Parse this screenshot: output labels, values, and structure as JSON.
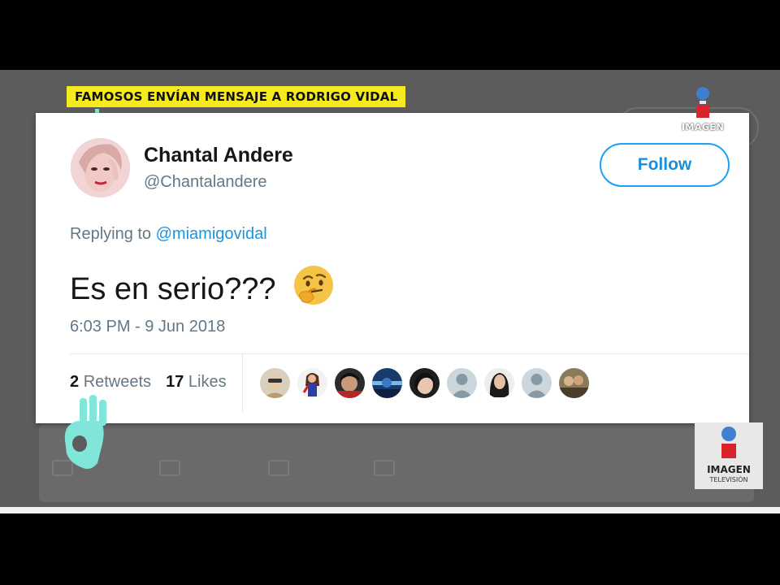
{
  "headline": "FAMOSOS ENVÍAN MENSAJE A RODRIGO VIDAL",
  "tweet": {
    "author_name": "Chantal Andere",
    "author_handle": "@Chantalandere",
    "follow_label": "Follow",
    "replying_prefix": "Replying to",
    "replying_to": "@miamigovidal",
    "text": "Es en serio???",
    "emoji": "thinking-face",
    "timestamp": "6:03 PM - 9 Jun 2018",
    "retweets_count": "2",
    "retweets_label": "Retweets",
    "likes_count": "17",
    "likes_label": "Likes",
    "liker_avatars": 9
  },
  "watermark": {
    "top": "IMAGEN",
    "brand": "IMAGEN",
    "brand_sub": "TELEVISIÓN"
  },
  "colors": {
    "headline_bg": "#f4ea1e",
    "follow_blue": "#1da1f2",
    "mention_blue": "#1b95e0",
    "ok_hand": "#7fe6d9",
    "logo_blue": "#3e7fd0",
    "logo_red": "#d8242a"
  }
}
